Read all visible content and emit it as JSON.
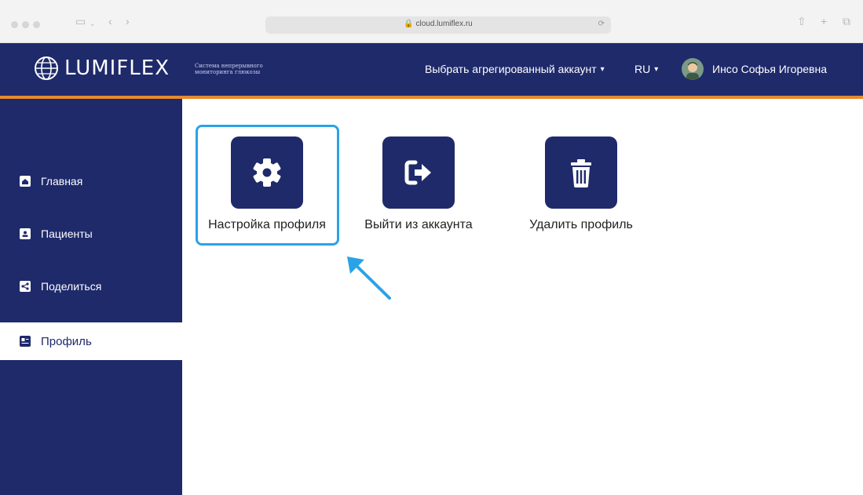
{
  "browser": {
    "url": "cloud.lumiflex.ru"
  },
  "header": {
    "logo": "LUMIFLEX",
    "tagline": "Система непрерывного мониторинга глюкозы",
    "account_select": "Выбрать агрегированный аккаунт",
    "language": "RU",
    "user_name": "Инсо Софья Игоревна"
  },
  "sidebar": {
    "items": [
      {
        "label": "Главная",
        "icon": "home-icon"
      },
      {
        "label": "Пациенты",
        "icon": "id-card-icon"
      },
      {
        "label": "Поделиться",
        "icon": "share-icon"
      },
      {
        "label": "Профиль",
        "icon": "profile-icon",
        "active": true
      }
    ]
  },
  "main": {
    "tiles": [
      {
        "label": "Настройка профиля",
        "icon": "gear-icon",
        "highlighted": true
      },
      {
        "label": "Выйти из аккаунта",
        "icon": "logout-icon"
      },
      {
        "label": "Удалить профиль",
        "icon": "trash-icon"
      }
    ]
  },
  "colors": {
    "brand_navy": "#1f2a6b",
    "accent_orange": "#e58a2e",
    "highlight_blue": "#2aa3e6"
  }
}
